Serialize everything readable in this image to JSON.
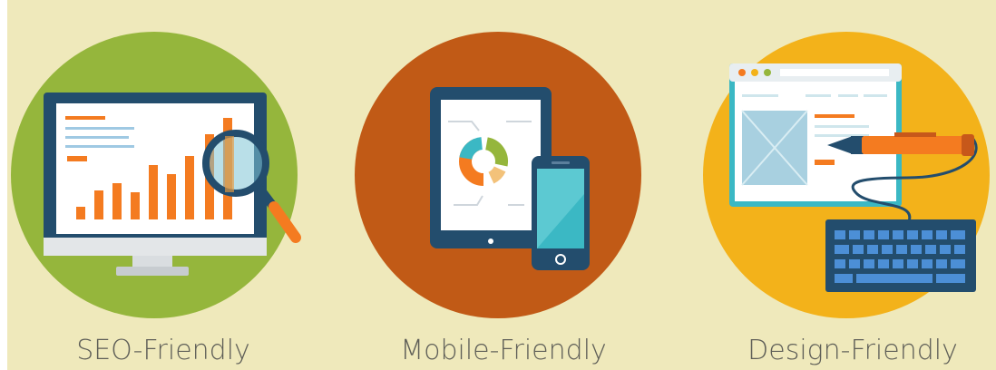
{
  "features": [
    {
      "label": "SEO-Friendly",
      "icon": "monitor-chart-magnifier-icon",
      "circle_color": "#95b63c"
    },
    {
      "label": "Mobile-Friendly",
      "icon": "tablet-phone-icon",
      "circle_color": "#c15a16"
    },
    {
      "label": "Design-Friendly",
      "icon": "browser-pen-keyboard-icon",
      "circle_color": "#f3b21a"
    }
  ],
  "colors": {
    "background": "#efe9bb",
    "navy": "#234d6d",
    "orange": "#f47b20",
    "teal": "#3bb8c4"
  }
}
